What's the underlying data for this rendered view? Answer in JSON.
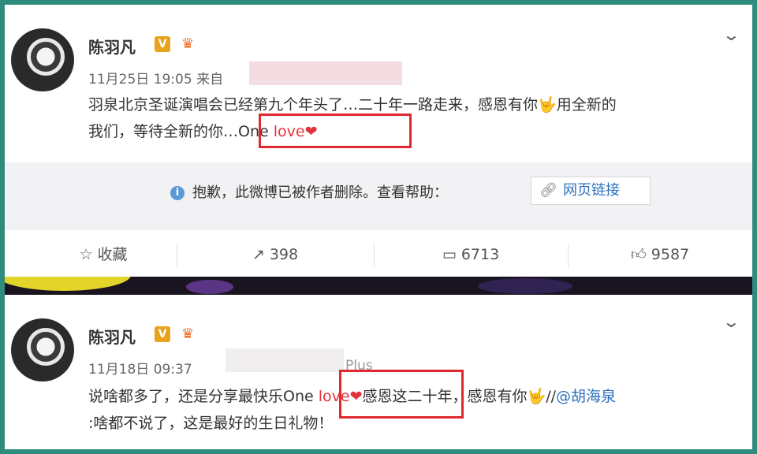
{
  "posts": [
    {
      "author": "陈羽凡",
      "v_badge": "V",
      "time": "11月25日 19:05",
      "source_prefix": "来自",
      "text": {
        "line1": "羽泉北京圣诞演唱会已经第九个年头了…二十年一路走来，感恩有你",
        "line1_tail": "用全新的",
        "line2_pre": "我们，等待全新的你…",
        "one": "One ",
        "love": "love"
      },
      "deleted_notice": "抱歉，此微博已被作者删除。查看帮助：",
      "web_link": "网页链接",
      "actions": {
        "favorite": "收藏",
        "repost": "398",
        "comment": "6713",
        "like": "9587"
      }
    },
    {
      "author": "陈羽凡",
      "v_badge": "V",
      "time": "11月18日 09:37",
      "source_suffix": "Plus",
      "text": {
        "line1_pre": "说啥都多了，还是分享最快乐",
        "one": "One ",
        "love": "love",
        "line1_post": "感恩这二十年，感恩有你",
        "mention_prefix": "//",
        "mention": "@胡海泉",
        "line2_post": ":啥都不说了，这是最好的生日礼物！"
      }
    }
  ],
  "icons": {
    "chevron": "chevron-down-icon",
    "info": "info-icon",
    "link": "link-icon",
    "star": "star-icon",
    "repost": "repost-icon",
    "comment": "comment-icon",
    "like": "thumbs-up-icon"
  },
  "colors": {
    "highlight_box": "#e0282f",
    "love_text": "#e8323b",
    "link": "#2c6fbb",
    "v_badge": "#e8a21b"
  }
}
